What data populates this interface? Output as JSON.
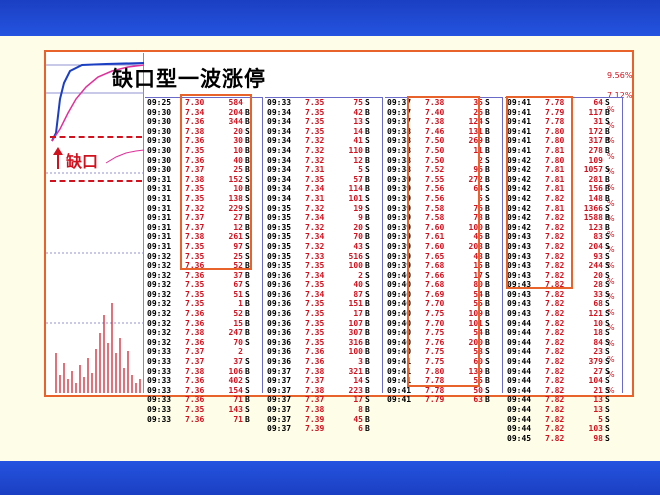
{
  "title": "缺口型一波涨停",
  "gap_label": "缺口",
  "right_axis": [
    "9.56%",
    "7.12%",
    "%",
    "%",
    "%",
    "%",
    "%",
    "%",
    "%",
    "%",
    "%",
    "%",
    "%",
    "%",
    "%",
    "%",
    "%",
    "%",
    "%",
    "%",
    "%"
  ],
  "colors": {
    "price": "#d0121f",
    "highlight": "#e8632b",
    "frame": "#1b3fc2"
  },
  "tables": [
    {
      "rows": [
        [
          "09:25",
          "7.30",
          "584",
          ""
        ],
        [
          "09:30",
          "7.34",
          "204",
          "B"
        ],
        [
          "09:30",
          "7.36",
          "344",
          "B"
        ],
        [
          "09:30",
          "7.38",
          "20",
          "S"
        ],
        [
          "09:30",
          "7.36",
          "30",
          "B"
        ],
        [
          "09:30",
          "7.35",
          "10",
          "B"
        ],
        [
          "09:30",
          "7.36",
          "40",
          "B"
        ],
        [
          "09:30",
          "7.37",
          "25",
          "B"
        ],
        [
          "09:31",
          "7.38",
          "152",
          "S"
        ],
        [
          "09:31",
          "7.35",
          "10",
          "B"
        ],
        [
          "09:31",
          "7.35",
          "138",
          "S"
        ],
        [
          "09:31",
          "7.32",
          "229",
          "S"
        ],
        [
          "09:31",
          "7.37",
          "27",
          "B"
        ],
        [
          "09:31",
          "7.37",
          "12",
          "B"
        ],
        [
          "09:31",
          "7.38",
          "261",
          "S"
        ],
        [
          "09:31",
          "7.35",
          "97",
          "S"
        ],
        [
          "09:32",
          "7.35",
          "25",
          "S"
        ],
        [
          "09:32",
          "7.36",
          "52",
          "B"
        ],
        [
          "09:32",
          "7.36",
          "37",
          "B"
        ],
        [
          "09:32",
          "7.35",
          "67",
          "S"
        ],
        [
          "09:32",
          "7.35",
          "51",
          "S"
        ],
        [
          "09:32",
          "7.35",
          "1",
          "B"
        ],
        [
          "09:32",
          "7.36",
          "52",
          "B"
        ],
        [
          "09:32",
          "7.36",
          "15",
          "B"
        ],
        [
          "09:32",
          "7.38",
          "247",
          "B"
        ],
        [
          "09:32",
          "7.36",
          "70",
          "S"
        ],
        [
          "09:33",
          "7.37",
          "2",
          ""
        ],
        [
          "09:33",
          "7.37",
          "37",
          "S"
        ],
        [
          "09:33",
          "7.38",
          "106",
          "B"
        ],
        [
          "09:33",
          "7.36",
          "402",
          "S"
        ],
        [
          "09:33",
          "7.36",
          "154",
          "S"
        ],
        [
          "09:33",
          "7.36",
          "71",
          "B"
        ],
        [
          "09:33",
          "7.35",
          "143",
          "S"
        ],
        [
          "09:33",
          "7.36",
          "71",
          "B"
        ]
      ]
    },
    {
      "rows": [
        [
          "09:33",
          "7.35",
          "75",
          "S"
        ],
        [
          "09:34",
          "7.35",
          "42",
          "B"
        ],
        [
          "09:34",
          "7.35",
          "13",
          "S"
        ],
        [
          "09:34",
          "7.35",
          "14",
          "B"
        ],
        [
          "09:34",
          "7.32",
          "41",
          "S"
        ],
        [
          "09:34",
          "7.32",
          "110",
          "B"
        ],
        [
          "09:34",
          "7.32",
          "12",
          "B"
        ],
        [
          "09:34",
          "7.31",
          "5",
          "S"
        ],
        [
          "09:34",
          "7.35",
          "57",
          "B"
        ],
        [
          "09:34",
          "7.34",
          "114",
          "B"
        ],
        [
          "09:34",
          "7.31",
          "101",
          "S"
        ],
        [
          "09:35",
          "7.32",
          "19",
          "S"
        ],
        [
          "09:35",
          "7.34",
          "9",
          "B"
        ],
        [
          "09:35",
          "7.32",
          "20",
          "S"
        ],
        [
          "09:35",
          "7.34",
          "70",
          "B"
        ],
        [
          "09:35",
          "7.32",
          "43",
          "S"
        ],
        [
          "09:35",
          "7.33",
          "516",
          "S"
        ],
        [
          "09:35",
          "7.35",
          "100",
          "B"
        ],
        [
          "09:36",
          "7.34",
          "2",
          "S"
        ],
        [
          "09:36",
          "7.35",
          "40",
          "S"
        ],
        [
          "09:36",
          "7.34",
          "87",
          "S"
        ],
        [
          "09:36",
          "7.35",
          "151",
          "B"
        ],
        [
          "09:36",
          "7.35",
          "17",
          "B"
        ],
        [
          "09:36",
          "7.35",
          "107",
          "B"
        ],
        [
          "09:36",
          "7.35",
          "307",
          "B"
        ],
        [
          "09:36",
          "7.35",
          "316",
          "B"
        ],
        [
          "09:36",
          "7.36",
          "100",
          "B"
        ],
        [
          "09:36",
          "7.36",
          "3",
          "B"
        ],
        [
          "09:37",
          "7.38",
          "321",
          "B"
        ],
        [
          "09:37",
          "7.37",
          "14",
          "S"
        ],
        [
          "09:37",
          "7.38",
          "223",
          "B"
        ],
        [
          "09:37",
          "7.37",
          "17",
          "S"
        ],
        [
          "09:37",
          "7.38",
          "8",
          "B"
        ],
        [
          "09:37",
          "7.39",
          "45",
          "B"
        ],
        [
          "09:37",
          "7.39",
          "6",
          "B"
        ]
      ]
    },
    {
      "rows": [
        [
          "09:37",
          "7.38",
          "35",
          "S"
        ],
        [
          "09:37",
          "7.40",
          "26",
          "B"
        ],
        [
          "09:37",
          "7.38",
          "124",
          "S"
        ],
        [
          "09:38",
          "7.46",
          "131",
          "B"
        ],
        [
          "09:38",
          "7.50",
          "269",
          "B"
        ],
        [
          "09:38",
          "7.50",
          "11",
          "B"
        ],
        [
          "09:38",
          "7.50",
          "2",
          "S"
        ],
        [
          "09:38",
          "7.52",
          "96",
          "B"
        ],
        [
          "09:39",
          "7.55",
          "272",
          "B"
        ],
        [
          "09:39",
          "7.56",
          "64",
          "S"
        ],
        [
          "09:39",
          "7.56",
          "5",
          "S"
        ],
        [
          "09:39",
          "7.58",
          "76",
          "B"
        ],
        [
          "09:39",
          "7.58",
          "73",
          "B"
        ],
        [
          "09:39",
          "7.60",
          "100",
          "B"
        ],
        [
          "09:39",
          "7.61",
          "46",
          "B"
        ],
        [
          "09:39",
          "7.60",
          "203",
          "B"
        ],
        [
          "09:39",
          "7.65",
          "43",
          "B"
        ],
        [
          "09:39",
          "7.68",
          "15",
          "B"
        ],
        [
          "09:40",
          "7.66",
          "17",
          "S"
        ],
        [
          "09:40",
          "7.68",
          "80",
          "B"
        ],
        [
          "09:40",
          "7.69",
          "54",
          "B"
        ],
        [
          "09:40",
          "7.70",
          "55",
          "B"
        ],
        [
          "09:40",
          "7.75",
          "109",
          "B"
        ],
        [
          "09:40",
          "7.70",
          "101",
          "S"
        ],
        [
          "09:40",
          "7.75",
          "54",
          "B"
        ],
        [
          "09:40",
          "7.76",
          "200",
          "B"
        ],
        [
          "09:40",
          "7.75",
          "53",
          "S"
        ],
        [
          "09:41",
          "7.75",
          "60",
          "S"
        ],
        [
          "09:41",
          "7.80",
          "139",
          "B"
        ],
        [
          "09:41",
          "7.78",
          "55",
          "B"
        ],
        [
          "09:41",
          "7.78",
          "50",
          "S"
        ],
        [
          "09:41",
          "7.79",
          "63",
          "B"
        ]
      ]
    },
    {
      "rows": [
        [
          "09:41",
          "7.78",
          "64",
          "S"
        ],
        [
          "09:41",
          "7.79",
          "117",
          "B"
        ],
        [
          "09:41",
          "7.78",
          "31",
          "S"
        ],
        [
          "09:41",
          "7.80",
          "172",
          "B"
        ],
        [
          "09:41",
          "7.80",
          "317",
          "B"
        ],
        [
          "09:41",
          "7.81",
          "278",
          "B"
        ],
        [
          "09:42",
          "7.80",
          "109",
          ""
        ],
        [
          "09:42",
          "7.81",
          "1057",
          "S"
        ],
        [
          "09:42",
          "7.81",
          "281",
          "B"
        ],
        [
          "09:42",
          "7.81",
          "156",
          "B"
        ],
        [
          "09:42",
          "7.82",
          "148",
          "B"
        ],
        [
          "09:42",
          "7.81",
          "1366",
          "S"
        ],
        [
          "09:42",
          "7.82",
          "1588",
          "B"
        ],
        [
          "09:42",
          "7.82",
          "123",
          "B"
        ],
        [
          "09:43",
          "7.82",
          "83",
          "S"
        ],
        [
          "09:43",
          "7.82",
          "204",
          "S"
        ],
        [
          "09:43",
          "7.82",
          "93",
          "S"
        ],
        [
          "09:43",
          "7.82",
          "244",
          "S"
        ],
        [
          "09:43",
          "7.82",
          "20",
          "S"
        ],
        [
          "09:43",
          "7.82",
          "28",
          "S"
        ],
        [
          "09:43",
          "7.82",
          "33",
          "S"
        ],
        [
          "09:43",
          "7.82",
          "68",
          "S"
        ],
        [
          "09:43",
          "7.82",
          "121",
          "S"
        ],
        [
          "09:44",
          "7.82",
          "10",
          "S"
        ],
        [
          "09:44",
          "7.82",
          "18",
          "S"
        ],
        [
          "09:44",
          "7.82",
          "84",
          "S"
        ],
        [
          "09:44",
          "7.82",
          "23",
          "S"
        ],
        [
          "09:44",
          "7.82",
          "379",
          "S"
        ],
        [
          "09:44",
          "7.82",
          "27",
          "S"
        ],
        [
          "09:44",
          "7.82",
          "104",
          "S"
        ],
        [
          "09:44",
          "7.82",
          "21",
          "S"
        ],
        [
          "09:44",
          "7.82",
          "13",
          "S"
        ],
        [
          "09:44",
          "7.82",
          "13",
          "S"
        ],
        [
          "09:44",
          "7.82",
          "5",
          "S"
        ],
        [
          "09:44",
          "7.82",
          "103",
          "S"
        ],
        [
          "09:45",
          "7.82",
          "98",
          "S"
        ]
      ]
    }
  ]
}
